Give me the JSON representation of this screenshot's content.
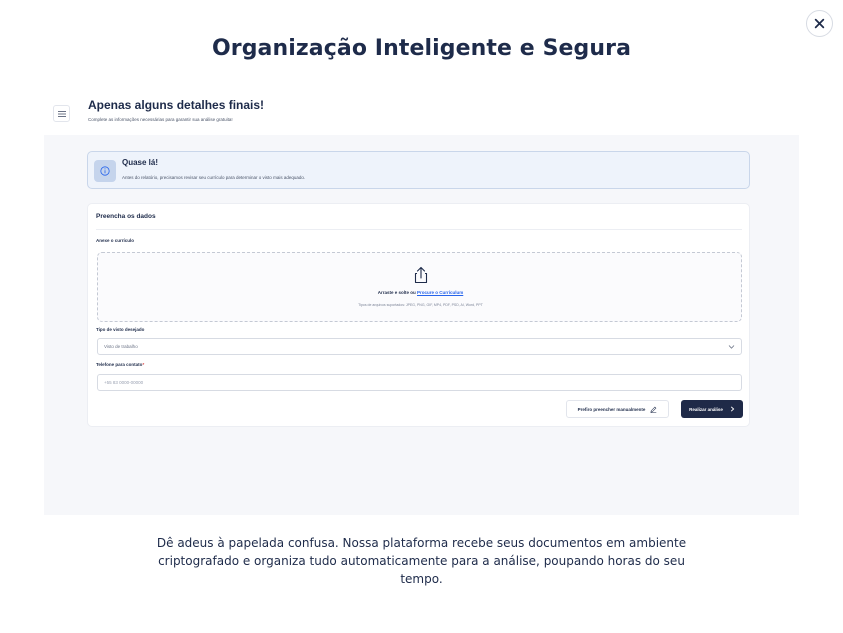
{
  "modal": {
    "title": "Organização Inteligente e Segura",
    "description": "Dê adeus à papelada confusa. Nossa plataforma recebe seus documentos em ambiente criptografado e organiza tudo automaticamente para a análise, poupando horas do seu tempo."
  },
  "preview": {
    "header": {
      "title": "Apenas alguns detalhes finais!",
      "subtitle": "Complete as informações necessárias para garantir sua análise gratuita!"
    },
    "notice": {
      "title": "Quase lá!",
      "text": "Antes do relatório, precisamos revisar seu currículo para determinar o visto mais adequado."
    },
    "form": {
      "title": "Preencha os dados",
      "resume_label": "Anexe o currículo",
      "drop_text": "Arraste e solte ou",
      "drop_link": "Procure o Currículum",
      "drop_hint": "Tipos de arquivos suportados: JPEG, PNG, GIF, MP4, PDF, PSD, AI, Word, PPT",
      "visa_label": "Tipo de visto desejado",
      "visa_value": "Visto de trabalho",
      "phone_label": "Telefone para contato",
      "phone_required": "*",
      "phone_placeholder": "+55 83 0000-00000",
      "manual_button": "Prefiro preencher manualmente",
      "submit_button": "Realizar análise"
    }
  },
  "icons": {
    "close": "close-icon",
    "menu": "menu-icon",
    "info": "info-icon",
    "upload": "upload-icon",
    "chevron": "chevron-down-icon",
    "edit": "pencil-icon",
    "arrow": "chevron-right-icon"
  },
  "colors": {
    "primary": "#1f2a48",
    "link": "#2563eb",
    "notice_bg": "#eef3fb"
  }
}
